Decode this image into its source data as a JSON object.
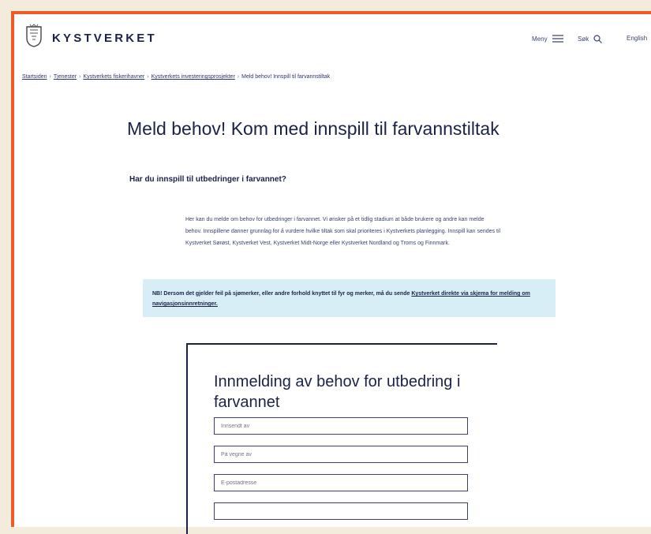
{
  "header": {
    "logo_text": "KYSTVERKET",
    "menu_label": "Meny",
    "search_label": "Søk",
    "lang_label": "English"
  },
  "breadcrumb": [
    "Startsiden",
    "Tjenester",
    "Kystverkets fiskerihavner",
    "Kystverkets investeringsprosjekter",
    "Meld behov! Innspill til farvannstiltak"
  ],
  "page": {
    "title": "Meld behov! Kom med innspill til farvannstiltak",
    "subtitle": "Har du innspill til utbedringer i farvannet?",
    "intro": "Her kan du melde om behov for utbedringer i farvannet. Vi ønsker på et tidlig stadium at både brukere og andre kan melde behov. Innspillene danner grunnlag for å vurdere hvilke tiltak som skal prioriteres i Kystverkets planlegging. Innspill kan sendes til Kystverket Sørøst, Kystverket Vest, Kystverket Midt-Norge eller Kystverket Nordland og Troms og Finnmark.",
    "notice_bold": "NB! Dersom det gjelder feil på sjømerker, eller andre forhold knyttet til fyr og merker, må du sende",
    "notice_link": "Kystverket direkte via skjema for melding om navigasjonsinnretninger."
  },
  "form": {
    "title": "Innmelding av behov for utbedring i farvannet",
    "fields": [
      {
        "placeholder": "Innsendt av"
      },
      {
        "placeholder": "På vegne av"
      },
      {
        "placeholder": "E-postadresse"
      },
      {
        "placeholder": ""
      }
    ]
  },
  "colors": {
    "brand_navy": "#1a2247",
    "frame_border": "#ee5a28",
    "notice_bg": "#d8eef7"
  }
}
